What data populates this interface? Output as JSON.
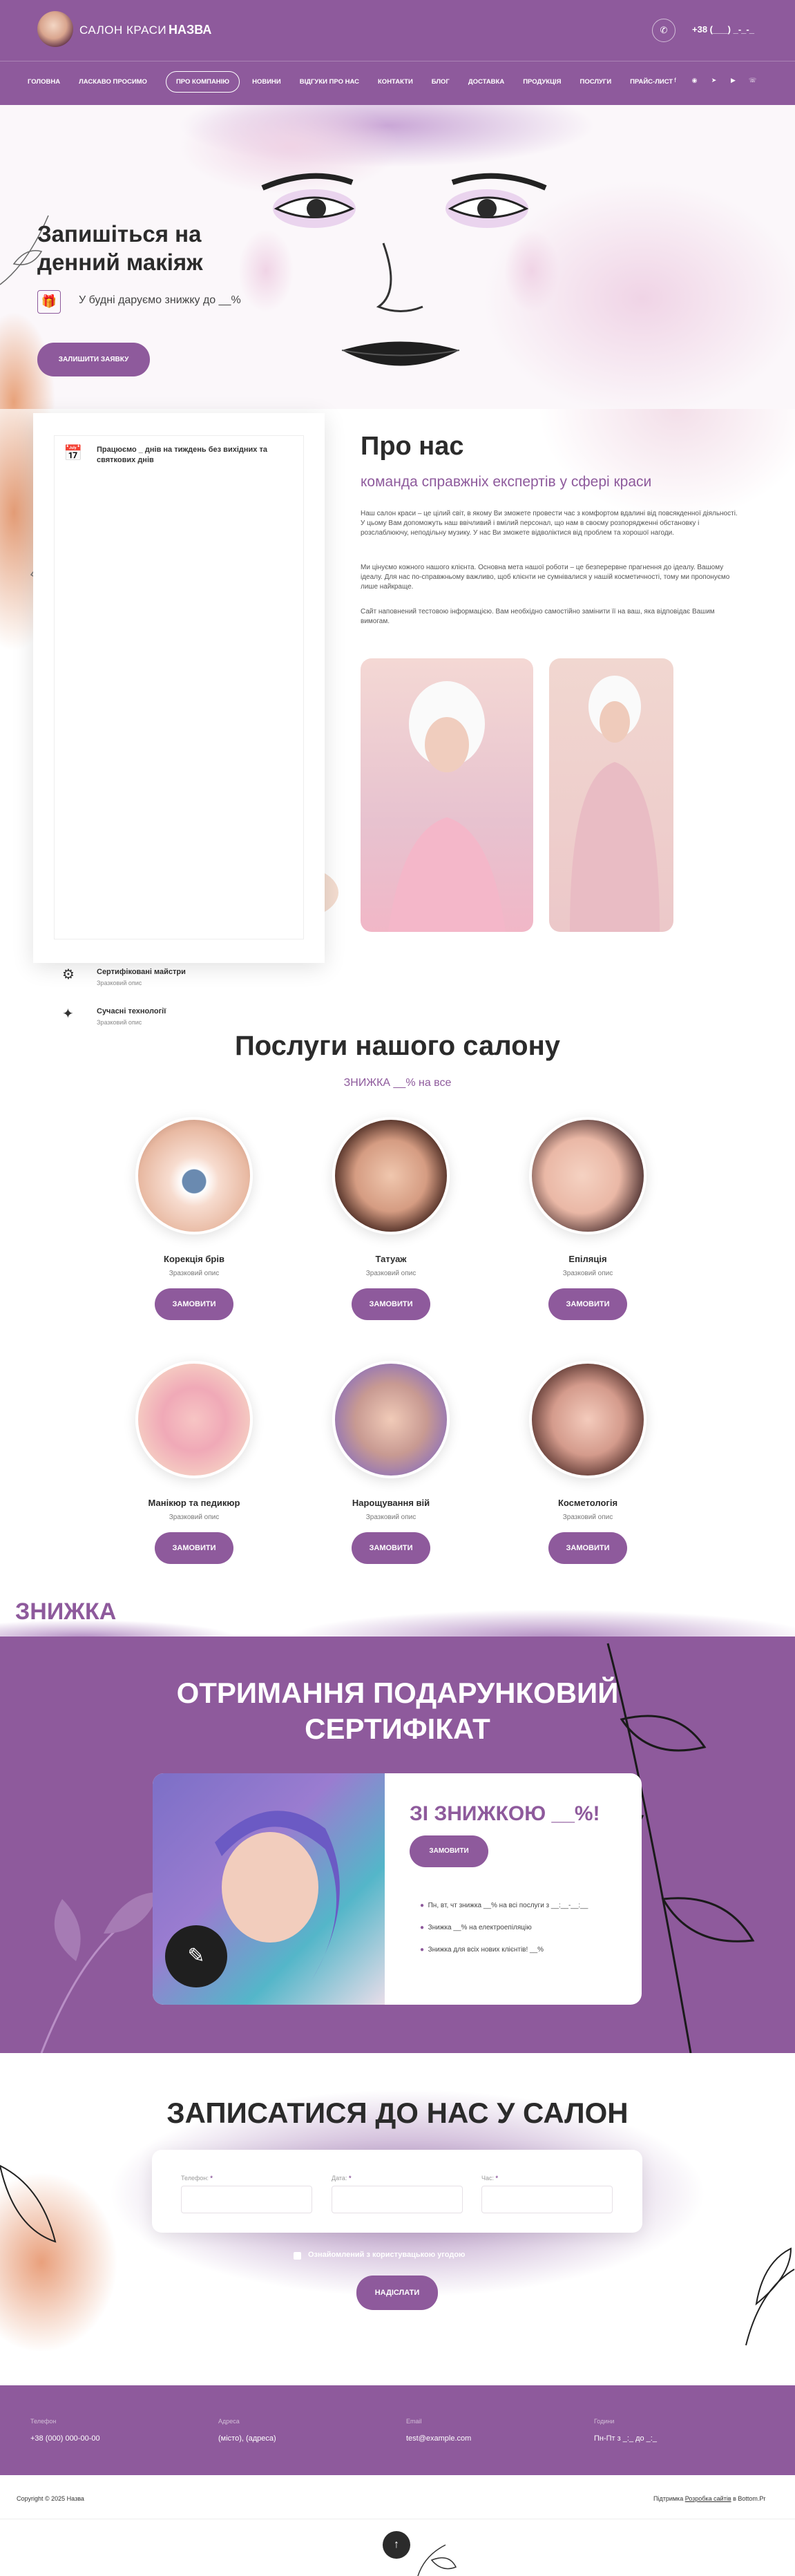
{
  "header": {
    "brand": "САЛОН КРАСИ",
    "name": "НАЗВА",
    "phone": "+38 (___) _-_-_"
  },
  "nav": [
    "ГОЛОВНА",
    "ЛАСКАВО ПРОСИМО",
    "ПРО КОМПАНІЮ",
    "НОВИНИ",
    "ВІДГУКИ ПРО НАС",
    "КОНТАКТИ",
    "БЛОГ",
    "ДОСТАВКА",
    "ПРОДУКЦІЯ",
    "ПОСЛУГИ",
    "ПРАЙС-ЛИСТ"
  ],
  "social_icons": [
    "facebook-icon",
    "instagram-icon",
    "telegram-icon",
    "youtube-icon",
    "viber-icon"
  ],
  "hero": {
    "title_line1": "Запишіться на",
    "title_line2": "денний макіяж",
    "subtitle": "У будні даруємо знижку до __%",
    "button": "ЗАЛИШИТИ ЗАЯВКУ"
  },
  "hours": {
    "text": "Працюємо _ днів на тиждень без вихідних та святкових днів"
  },
  "features": [
    {
      "title": "Сертифіковані майстри",
      "desc": "Зразковий опис"
    },
    {
      "title": "Сучасні технології",
      "desc": "Зразковий опис"
    }
  ],
  "about": {
    "title": "Про нас",
    "subtitle": "команда справжніх експертів у сфері краси",
    "p1": "Наш салон краси – це цілий світ, в якому Ви зможете провести час з комфортом вдалині від повсякденної діяльності. У цьому Вам допоможуть наш ввічливий і вмілий персонал, що нам в своєму розпорядженні обстановку і розслаблюючу, неподільну музику. У нас Ви зможете відволіктися від проблем та хорошої нагоди.",
    "p2": "Ми цінуємо кожного нашого клієнта. Основна мета нашої роботи – це безперервне прагнення до ідеалу. Вашому ідеалу. Для нас по-справжньому важливо, щоб клієнти не сумнівалися у нашій косметичності, тому ми пропонуємо лише найкраще.",
    "p3": "Сайт наповнений тестовою інформацією. Вам необхідно самостійно замінити її на ваш, яка відповідає Вашим вимогам."
  },
  "services": {
    "title": "Послуги нашого салону",
    "subtitle": "ЗНИЖКА __% на все",
    "items": [
      {
        "name": "Корекція брів",
        "desc": "Зразковий опис",
        "button": "ЗАМОВИТИ"
      },
      {
        "name": "Татуаж",
        "desc": "Зразковий опис",
        "button": "ЗАМОВИТИ"
      },
      {
        "name": "Епіляція",
        "desc": "Зразковий опис",
        "button": "ЗАМОВИТИ"
      },
      {
        "name": "Манікюр та педикюр",
        "desc": "Зразковий опис",
        "button": "ЗАМОВИТИ"
      },
      {
        "name": "Нарощування вій",
        "desc": "Зразковий опис",
        "button": "ЗАМОВИТИ"
      },
      {
        "name": "Косметологія",
        "desc": "Зразковий опис",
        "button": "ЗАМОВИТИ"
      }
    ]
  },
  "discount": {
    "label": "ЗНИЖКА",
    "title_line1": "ОТРИМАННЯ ПОДАРУНКОВИЙ",
    "title_line2": "СЕРТИФІКАТ",
    "promo": "ЗІ ЗНИЖКОЮ __%!",
    "button": "ЗАМОВИТИ",
    "items": [
      "Пн, вт, чт знижка __% на всі послуги з __:__-__:__",
      "Знижка __% на електроепіляцію",
      "Знижка для всіх нових клієнтів! __%"
    ]
  },
  "booking": {
    "title": "ЗАПИСАТИСЯ ДО НАС У САЛОН",
    "fields": [
      {
        "label": "Телефон:"
      },
      {
        "label": "Дата:"
      },
      {
        "label": "Час:"
      }
    ],
    "consent": "Ознайомлений з користувацькою угодою",
    "button": "НАДІСЛАТИ"
  },
  "footer": {
    "cols": [
      {
        "label": "Телефон",
        "value": "+38 (000) 000-00-00"
      },
      {
        "label": "Адреса",
        "value": "(місто), (адреса)"
      },
      {
        "label": "Email",
        "value": "test@example.com"
      },
      {
        "label": "Години",
        "value": "Пн-Пт з _:_ до _:_"
      }
    ],
    "copyright": "Copyright © 2025 Назва",
    "made": "Підтримка",
    "made_link": "Розробка сайтів",
    "made_by": "в Bottom.Pr"
  },
  "colors": {
    "accent": "#8e5a9c",
    "dark": "#2b2b2b"
  }
}
